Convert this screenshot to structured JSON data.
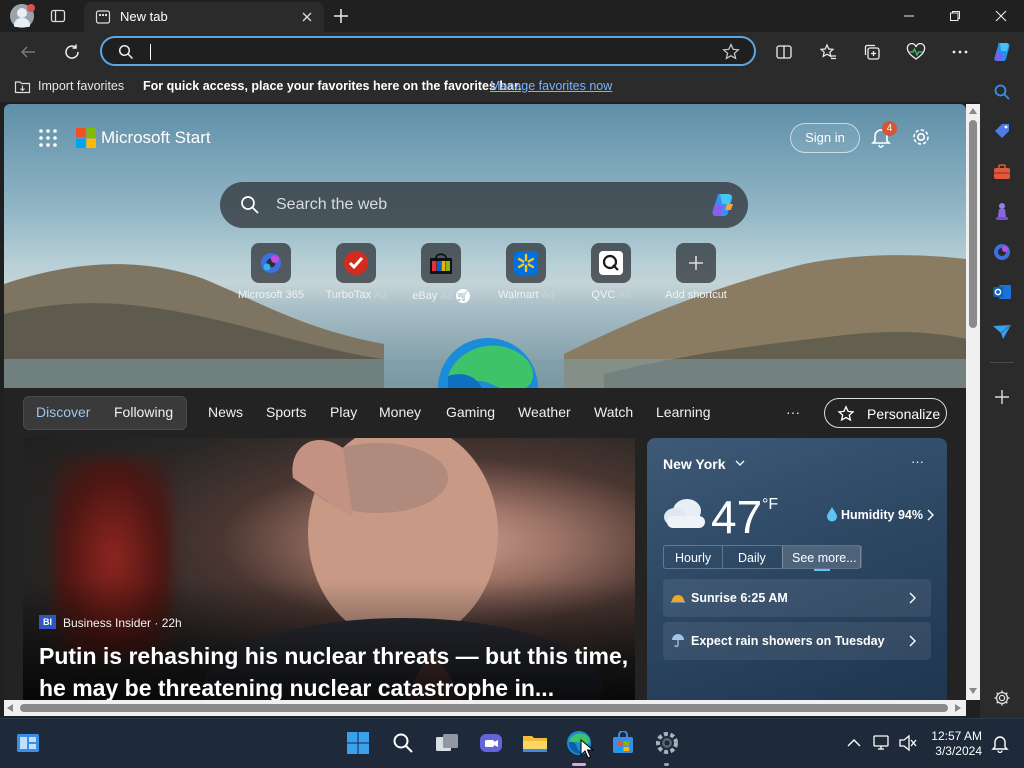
{
  "tab": {
    "title": "New tab"
  },
  "address_bar": {
    "value": ""
  },
  "favorites_bar": {
    "import_label": "Import favorites",
    "quick_access_text": "For quick access, place your favorites here on the favorites bar.",
    "manage_link": "Manage favorites now"
  },
  "header": {
    "brand": "Microsoft Start",
    "sign_in": "Sign in",
    "notification_count": "4"
  },
  "search": {
    "placeholder": "Search the web"
  },
  "shortcuts": [
    {
      "name": "Microsoft 365",
      "ad": ""
    },
    {
      "name": "TurboTax",
      "ad": "Ad"
    },
    {
      "name": "eBay",
      "ad": "Ad"
    },
    {
      "name": "Walmart",
      "ad": "Ad"
    },
    {
      "name": "QVC",
      "ad": "Ad"
    },
    {
      "name": "Add shortcut",
      "ad": ""
    }
  ],
  "nav": {
    "discover": "Discover",
    "following": "Following",
    "items": [
      "News",
      "Sports",
      "Play",
      "Money",
      "Gaming",
      "Weather",
      "Watch",
      "Learning"
    ],
    "more": "···",
    "personalize": "Personalize"
  },
  "story": {
    "source": "Business Insider · 22h",
    "source_badge": "BI",
    "headline": "Putin is rehashing his nuclear threats — but this time, he may be threatening nuclear catastrophe in..."
  },
  "weather": {
    "location": "New York",
    "temperature": "47",
    "unit": "°F",
    "humidity": "Humidity 94%",
    "tabs": [
      "Hourly",
      "Daily",
      "See more..."
    ],
    "sunrise": "Sunrise 6:25 AM",
    "forecast": "Expect rain showers on Tuesday",
    "more": "···"
  },
  "taskbar": {
    "time": "12:57 AM",
    "date": "3/3/2024"
  },
  "colors": {
    "accent": "#5aa7e6",
    "link": "#78b4ff",
    "notification_badge": "#d65532",
    "edge_blue": "#1a8cd8",
    "edge_green": "#3ec36b"
  }
}
